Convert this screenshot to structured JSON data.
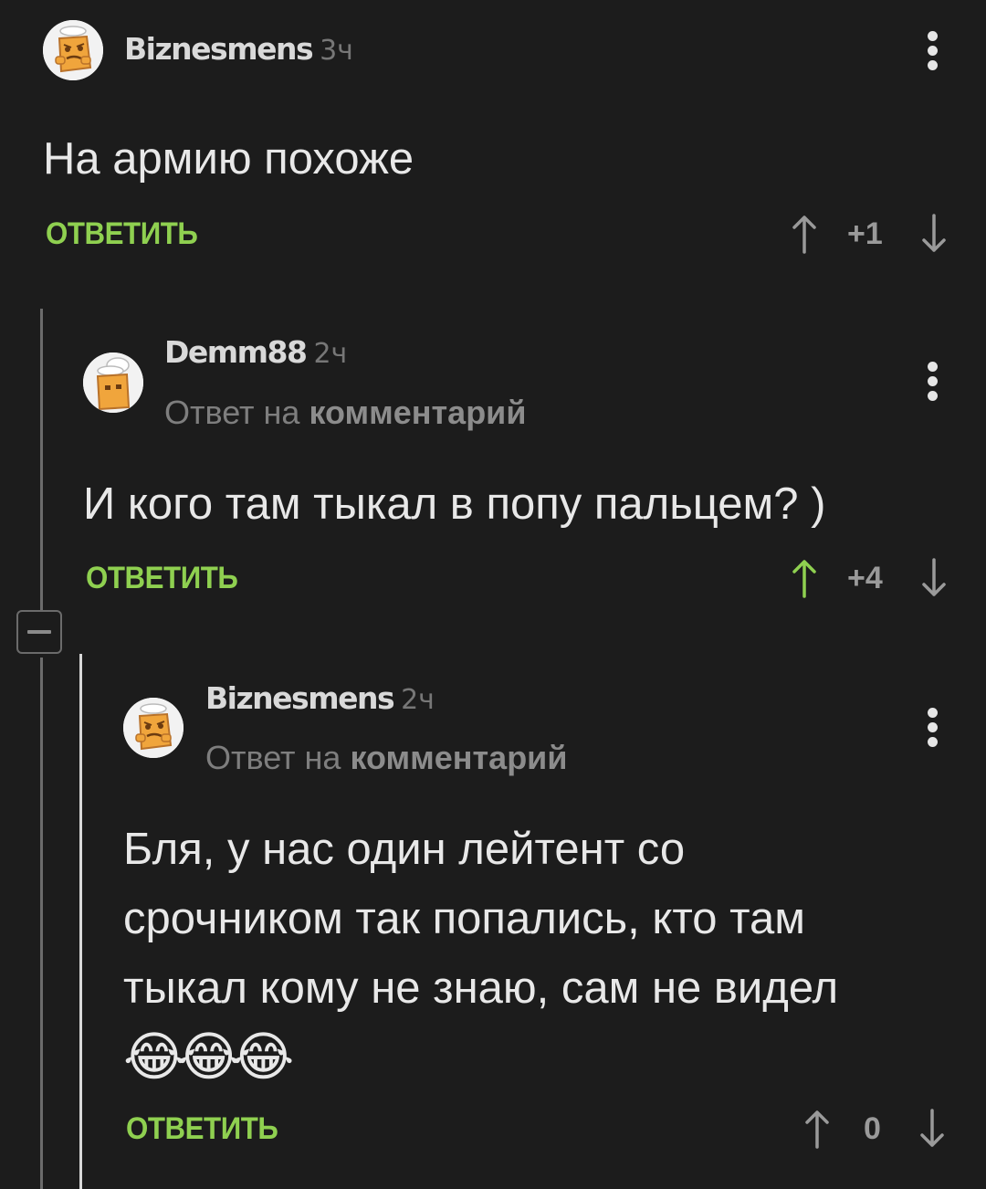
{
  "comments": [
    {
      "username": "Biznesmens",
      "time": "3ч",
      "text": "На армию похоже",
      "reply_label": "ОТВЕТИТЬ",
      "score": "+1",
      "upvoted": false
    },
    {
      "username": "Demm88",
      "time": "2ч",
      "reply_prefix": "Ответ на",
      "reply_link": "комментарий",
      "text": "И кого там тыкал в попу пальцем? )",
      "reply_label": "ОТВЕТИТЬ",
      "score": "+4",
      "upvoted": true
    },
    {
      "username": "Biznesmens",
      "time": "2ч",
      "reply_prefix": "Ответ на",
      "reply_link": "комментарий",
      "text_lines": [
        "Бля, у нас один лейтент со",
        "срочником так попались, кто там",
        "тыкал кому не знаю, сам не видел",
        "😂😂😂"
      ],
      "reply_label": "ОТВЕТИТЬ",
      "score": "0",
      "upvoted": false
    }
  ],
  "icons": {
    "upvote": "arrow-up-icon",
    "downvote": "arrow-down-icon",
    "more": "more-vertical-icon",
    "collapse": "minus-collapse-icon"
  },
  "colors": {
    "background": "#1c1c1c",
    "accent_green": "#8fd050",
    "text": "#e8e8e8",
    "muted": "#7e7e7e"
  }
}
